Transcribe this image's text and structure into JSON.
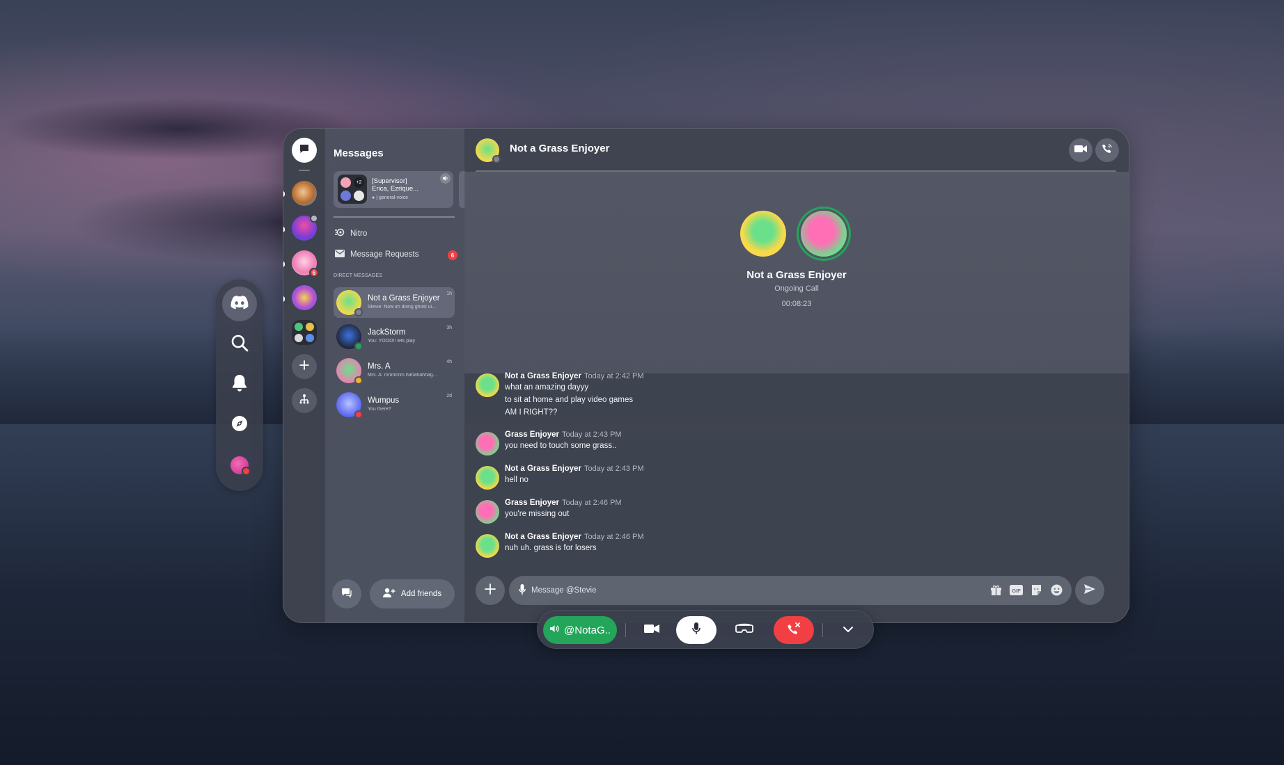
{
  "colors": {
    "online": "#23a55a",
    "danger": "#f23f43",
    "idle": "#f0b232"
  },
  "float_nav": {
    "items": [
      {
        "icon": "discord-logo-icon",
        "active": true
      },
      {
        "icon": "search-icon"
      },
      {
        "icon": "bell-icon"
      },
      {
        "icon": "compass-icon"
      },
      {
        "icon": "user-avatar-icon"
      }
    ]
  },
  "server_rail": {
    "home_icon": "chat-bubble-icon",
    "servers": [
      {
        "icon": "server-cat-icon",
        "badge": ""
      },
      {
        "icon": "server-character-icon",
        "badge": ""
      },
      {
        "icon": "server-pink-icon",
        "badge": "6"
      },
      {
        "icon": "server-group-icon",
        "badge": ""
      },
      {
        "icon": "server-folder-icon",
        "badge": ""
      }
    ],
    "add_icon": "plus-icon",
    "hub_icon": "hierarchy-icon"
  },
  "dm_panel": {
    "title": "Messages",
    "voice_card": {
      "line1": "[Supervisor]",
      "line2": "Erica, Ezrique...",
      "channel": "| general-voice",
      "extra_count": "+2"
    },
    "nitro_label": "Nitro",
    "requests_label": "Message Requests",
    "requests_badge": "6",
    "section_header": "DIRECT MESSAGES",
    "dms": [
      {
        "name": "Not a Grass Enjoyer",
        "preview": "Stevie: Now im doing ghost ui...",
        "time": "1h",
        "status": "offline"
      },
      {
        "name": "JackStorm",
        "preview": "You: YOOO!! lets play",
        "time": "3h",
        "status": "online"
      },
      {
        "name": "Mrs. A",
        "preview": "Mrs. A: mmmmm hahahahhag...",
        "time": "4h",
        "status": "idle"
      },
      {
        "name": "Wumpus",
        "preview": "You there?",
        "time": "2d",
        "status": "dnd"
      }
    ],
    "add_friends_label": "Add friends"
  },
  "chat": {
    "header_name": "Not a Grass Enjoyer",
    "call": {
      "name": "Not a Grass Enjoyer",
      "status": "Ongoing Call",
      "timer": "00:08:23"
    },
    "messages": [
      {
        "author": "Not a Grass Enjoyer",
        "time": "Today at 2:42 PM",
        "lines": [
          "what an amazing dayyy",
          "to sit at home and play video games",
          "AM I RIGHT??"
        ],
        "avatar": "green"
      },
      {
        "author": "Grass Enjoyer",
        "time": "Today at 2:43 PM",
        "lines": [
          "you need to touch some grass.."
        ],
        "avatar": "pink"
      },
      {
        "author": "Not a Grass Enjoyer",
        "time": "Today at 2:43 PM",
        "lines": [
          "hell no"
        ],
        "avatar": "green"
      },
      {
        "author": "Grass Enjoyer",
        "time": "Today at 2:46 PM",
        "lines": [
          "you're missing out"
        ],
        "avatar": "pink"
      },
      {
        "author": "Not a Grass Enjoyer",
        "time": "Today at 2:46 PM",
        "lines": [
          "nuh uh. grass is for losers"
        ],
        "avatar": "green"
      }
    ],
    "composer_placeholder": "Message @Stevie"
  },
  "callbar": {
    "voice_label": "@NotaG.."
  }
}
